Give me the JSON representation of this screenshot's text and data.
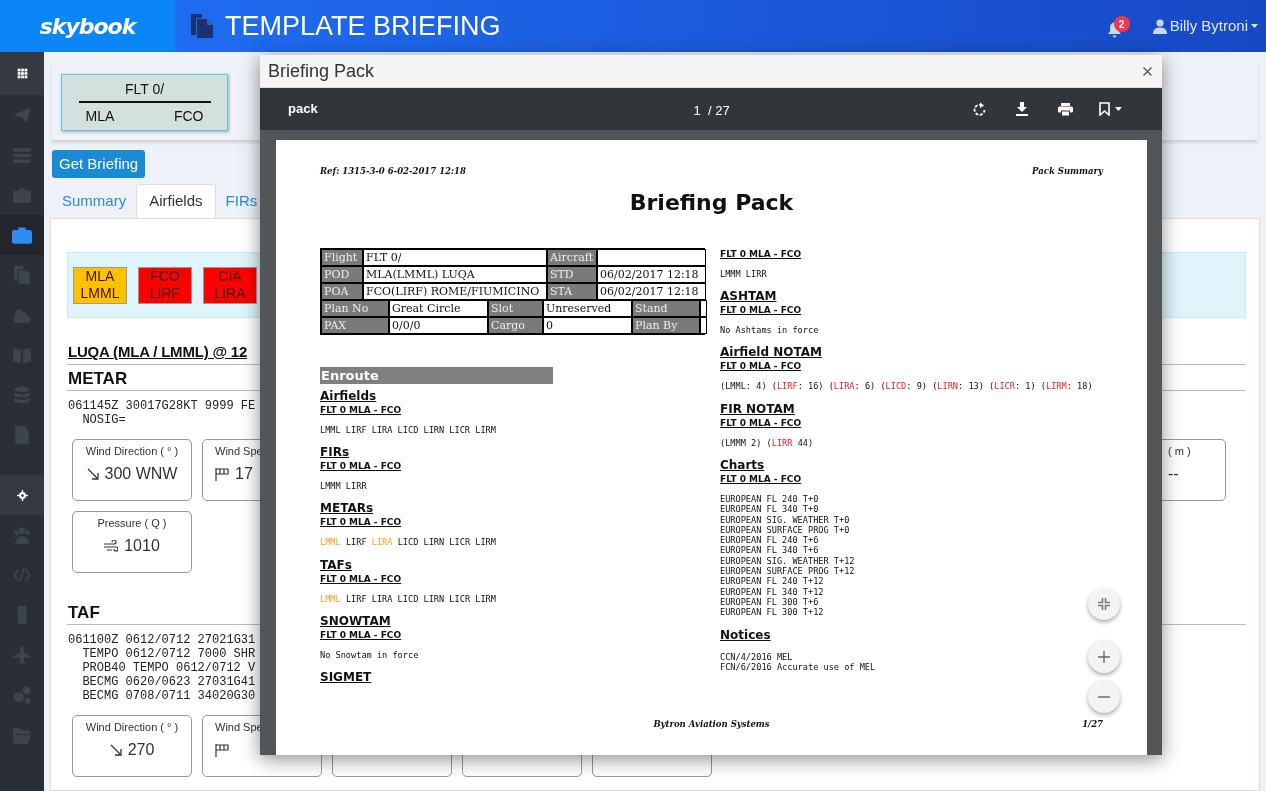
{
  "header": {
    "logo": "skybook",
    "title": "TEMPLATE BRIEFING",
    "notification_count": "2",
    "user": "Billy Bytroni"
  },
  "sidebar": {
    "items": [
      {
        "kind": "header",
        "selected": false
      },
      {
        "kind": "link",
        "selected": false
      },
      {
        "kind": "link",
        "selected": false
      },
      {
        "kind": "link",
        "selected": false
      },
      {
        "kind": "link",
        "selected": true
      },
      {
        "kind": "link",
        "selected": false
      },
      {
        "kind": "link",
        "selected": false
      },
      {
        "kind": "link",
        "selected": false
      },
      {
        "kind": "link",
        "selected": false
      },
      {
        "kind": "link",
        "selected": false
      },
      {
        "kind": "header",
        "selected": false
      },
      {
        "kind": "link",
        "selected": false
      },
      {
        "kind": "link",
        "selected": false
      },
      {
        "kind": "link",
        "selected": false
      },
      {
        "kind": "link",
        "selected": false
      },
      {
        "kind": "link",
        "selected": false
      },
      {
        "kind": "link",
        "selected": false
      }
    ]
  },
  "flight_card": {
    "flight": "FLT 0/",
    "origin": "MLA",
    "destination": "FCO"
  },
  "get_briefing_button": "Get Briefing",
  "tabs": [
    {
      "label": "Summary",
      "selected": false
    },
    {
      "label": "Airfields",
      "selected": true
    },
    {
      "label": "FIRs",
      "selected": false
    }
  ],
  "airfields": [
    {
      "iata": "MLA",
      "icao": "LMML",
      "color": "#ffc000"
    },
    {
      "iata": "FCO",
      "icao": "LIRF",
      "color": "#ff0000"
    },
    {
      "iata": "CIA",
      "icao": "LIRA",
      "color": "#ff0000"
    }
  ],
  "airfield_heading": "LUQA (MLA / LMML) @ 12",
  "metar": {
    "title": "METAR",
    "lines": [
      "061145Z 30017G28KT 9999 FE",
      "NOSIG="
    ],
    "card_rows": [
      [
        {
          "kind": "direction",
          "label": "Wind Direction ( ° )",
          "value": "300 WNW"
        },
        {
          "kind": "speed",
          "label": "Wind Spe",
          "value": "17"
        },
        {
          "kind": "visibility",
          "label": "( m )",
          "value": "--"
        }
      ],
      [
        {
          "kind": "pressure",
          "label": "Pressure ( Q )",
          "value": "1010"
        }
      ]
    ]
  },
  "taf": {
    "title": "TAF",
    "lines": [
      "061100Z 0612/0712 27021G31",
      "TEMPO 0612/0712 7000 SHR",
      "PROB40 TEMPO 0612/0712 V",
      "BECMG 0620/0623 27031G41",
      "BECMG 0708/0711 34020G30"
    ],
    "card_rows": [
      [
        {
          "kind": "direction",
          "label": "Wind Direction ( ° )",
          "value": "270"
        },
        {
          "kind": "speed",
          "label": "Wind Spe"
        },
        {
          "kind": "blank"
        },
        {
          "kind": "blank"
        },
        {
          "kind": "blank"
        }
      ]
    ]
  },
  "viewer": {
    "title": "Briefing Pack",
    "document": "pack",
    "page_input": "1",
    "page_count": "/ 27",
    "page": {
      "ref": "Ref: 1315-3-0 6-02-2017 12:18",
      "section_label": "Pack Summary",
      "title": "Briefing Pack",
      "summary_table": [
        [
          {
            "text": "Flight",
            "header": true
          },
          {
            "text": "FLT 0/",
            "header": false
          },
          {
            "text": "Aircraft",
            "header": true
          },
          {
            "header": false
          }
        ],
        [
          {
            "text": "POD",
            "header": true
          },
          {
            "text": "MLA(LMML) LUQA",
            "header": false
          },
          {
            "text": "STD",
            "header": true
          },
          {
            "text": "06/02/2017 12:18",
            "header": false
          }
        ],
        [
          {
            "text": "POA",
            "header": true
          },
          {
            "text": "FCO(LIRF) ROME/FIUMICINO",
            "header": false
          },
          {
            "text": "STA",
            "header": true
          },
          {
            "text": "06/02/2017 12:18",
            "header": false
          }
        ],
        [
          {
            "text": "Plan No",
            "header": true
          },
          {
            "text": "Great Circle",
            "header": false
          },
          {
            "text": "Slot",
            "header": true
          },
          {
            "text": "Unreserved",
            "header": false
          },
          {
            "text": "Stand",
            "header": true
          },
          {
            "header": false
          }
        ],
        [
          {
            "text": "PAX",
            "header": true
          },
          {
            "text": "0/0/0",
            "header": false
          },
          {
            "text": "Cargo",
            "header": true
          },
          {
            "text": "0",
            "header": false
          },
          {
            "text": "Plan By",
            "header": true
          },
          {
            "header": false
          }
        ]
      ],
      "enroute": "Enroute",
      "left_sections": [
        {
          "title": "Airfields",
          "flight": "FLT 0 MLA - FCO",
          "lines": [
            [
              {
                "text": "LMML LIRF LIRA LICD LIRN LICR LIRM",
                "highlighted": false
              }
            ]
          ]
        },
        {
          "title": "FIRs",
          "flight": "FLT 0 MLA - FCO",
          "lines": [
            [
              {
                "text": "LMMM LIRR",
                "highlighted": false
              }
            ]
          ]
        },
        {
          "title": "METARs",
          "flight": "FLT 0 MLA - FCO",
          "lines": [
            [
              {
                "text": "LMML",
                "highlighted": true
              },
              {
                "text": " LIRF ",
                "highlighted": false
              },
              {
                "text": "LIRA",
                "highlighted": true
              },
              {
                "text": " LICD LIRN LICR LIRM",
                "highlighted": false
              }
            ]
          ]
        },
        {
          "title": "TAFs",
          "flight": "FLT 0 MLA - FCO",
          "lines": [
            [
              {
                "text": "LMML",
                "highlighted": true
              },
              {
                "text": " LIRF LIRA LICD LIRN LICR LIRM",
                "highlighted": false
              }
            ]
          ]
        },
        {
          "title": "SNOWTAM",
          "flight": "FLT 0 MLA - FCO",
          "lines": [
            [
              {
                "text": "No Snowtam in force",
                "highlighted": false
              }
            ]
          ]
        },
        {
          "title": "SIGMET"
        }
      ],
      "right_sections": [
        {
          "flight": "FLT 0 MLA - FCO",
          "lines": [
            [
              {
                "text": "LMMM LIRR",
                "highlighted": false
              }
            ]
          ]
        },
        {
          "title": "ASHTAM",
          "flight": "FLT 0 MLA - FCO",
          "lines": [
            [
              {
                "text": "No Ashtams in force",
                "highlighted": false
              }
            ]
          ]
        },
        {
          "title": "Airfield NOTAM",
          "flight": "FLT 0 MLA - FCO",
          "lines": [
            [
              {
                "text": "(LMML: 4) (",
                "highlighted": false
              },
              {
                "text": "LIRF",
                "highlighted": true
              },
              {
                "text": ": 16) (",
                "highlighted": false
              },
              {
                "text": "LIRA",
                "highlighted": true
              },
              {
                "text": ": 6) (",
                "highlighted": false
              },
              {
                "text": "LICD",
                "highlighted": true
              },
              {
                "text": ": 9) (",
                "highlighted": false
              },
              {
                "text": "LIRN",
                "highlighted": true
              },
              {
                "text": ": 13) (",
                "highlighted": false
              },
              {
                "text": "LICR",
                "highlighted": true
              },
              {
                "text": ": 1) (",
                "highlighted": false
              },
              {
                "text": "LIRM",
                "highlighted": true
              },
              {
                "text": ": 18)",
                "highlighted": false
              }
            ]
          ]
        },
        {
          "title": "FIR NOTAM",
          "flight": "FLT 0 MLA - FCO",
          "lines": [
            [
              {
                "text": "(LMMM 2) (",
                "highlighted": false
              },
              {
                "text": "LIRR",
                "highlighted": true
              },
              {
                "text": " 44)",
                "highlighted": false
              }
            ]
          ]
        },
        {
          "title": "Charts",
          "flight": "FLT 0 MLA - FCO",
          "lines": [
            [
              {
                "text": "EUROPEAN FL 240 T+0",
                "highlighted": false
              }
            ],
            [
              {
                "text": "EUROPEAN FL 340 T+0",
                "highlighted": false
              }
            ],
            [
              {
                "text": "EUROPEAN SIG. WEATHER T+0",
                "highlighted": false
              }
            ],
            [
              {
                "text": "EUROPEAN SURFACE PROG T+0",
                "highlighted": false
              }
            ],
            [
              {
                "text": "EUROPEAN FL 240 T+6",
                "highlighted": false
              }
            ],
            [
              {
                "text": "EUROPEAN FL 340 T+6",
                "highlighted": false
              }
            ],
            [
              {
                "text": "EUROPEAN SIG. WEATHER T+12",
                "highlighted": false
              }
            ],
            [
              {
                "text": "EUROPEAN SURFACE PROG T+12",
                "highlighted": false
              }
            ],
            [
              {
                "text": "EUROPEAN FL 240 T+12",
                "highlighted": false
              }
            ],
            [
              {
                "text": "EUROPEAN FL 340 T+12",
                "highlighted": false
              }
            ],
            [
              {
                "text": "EUROPEAN FL 300 T+6",
                "highlighted": false
              }
            ],
            [
              {
                "text": "EUROPEAN FL 300 T+12",
                "highlighted": false
              }
            ]
          ]
        },
        {
          "title": "Notices",
          "lines": [
            [
              {
                "text": "CCN/4/2016 MEL",
                "highlighted": false
              }
            ],
            [
              {
                "text": "FCN/6/2016 Accurate use of MEL",
                "highlighted": false
              }
            ]
          ]
        }
      ],
      "footer_company": "Bytron Aviation Systems",
      "footer_page": "1/27"
    }
  }
}
